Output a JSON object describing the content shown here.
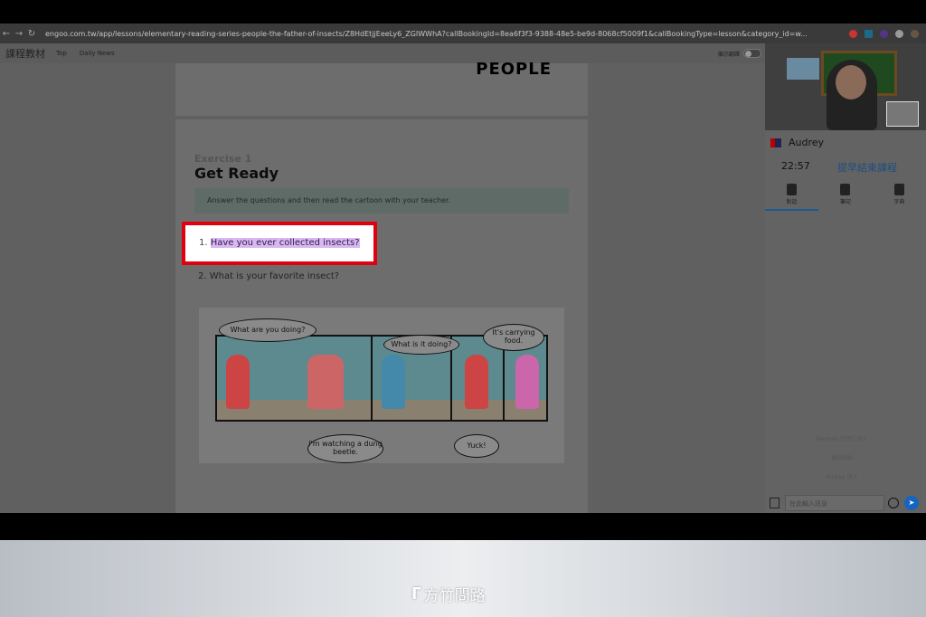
{
  "browser": {
    "url": "engoo.com.tw/app/lessons/elementary-reading-series-people-the-father-of-insects/Z8HdEtjjEeeLy6_ZGIWWhA?callBookingId=8ea6f3f3-9388-48e5-be9d-8068cf5009f1&callBookingType=lesson&category_id=w..."
  },
  "appbar": {
    "brand": "課程教材",
    "links": [
      "Top",
      "Daily News"
    ],
    "toggle_label": "顯示翻譯"
  },
  "lesson": {
    "header_partial": "PEOPLE",
    "exercise_label": "Exercise 1",
    "exercise_title": "Get Ready",
    "instruction": "Answer the questions and then read the cartoon with your teacher.",
    "questions": [
      {
        "num": "1.",
        "text": "Have you ever collected insects?"
      },
      {
        "num": "2.",
        "text": "What is your favorite insect?"
      }
    ],
    "cartoon_bubbles": [
      "What are you doing?",
      "I'm watching a dung beetle.",
      "What is it doing?",
      "It's carrying food.",
      "Yuck!"
    ]
  },
  "zoom_box": {
    "text": "1. Have you ever collected insects?",
    "border_color": "#e00010"
  },
  "sidebar": {
    "tutor_name": "Audrey",
    "timer": "22:57",
    "end_button": "提早結束課程",
    "tabs": [
      {
        "label": "對話",
        "icon": "chat-icon"
      },
      {
        "label": "筆記",
        "icon": "note-icon"
      },
      {
        "label": "字典",
        "icon": "dictionary-icon"
      }
    ],
    "messages": [
      "Bamboo (巴巴) 加入",
      "通話開始",
      "Audrey 加入"
    ],
    "chat_placeholder": "在此輸入訊息"
  },
  "footer": {
    "logo": "方竹問路"
  }
}
